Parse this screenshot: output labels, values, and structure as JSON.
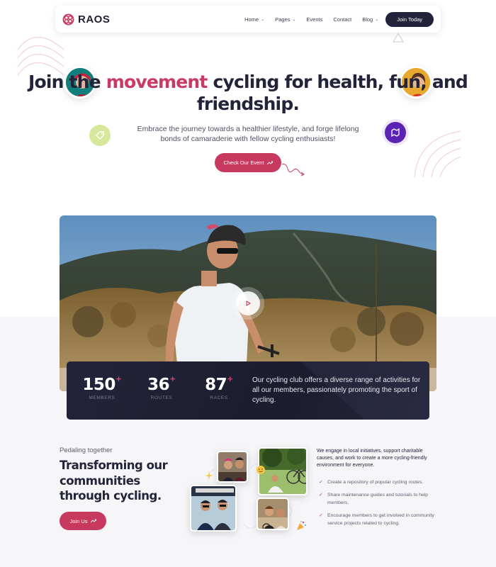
{
  "brand": {
    "name": "RAOS",
    "accent": "#c8395f",
    "dark": "#22233a"
  },
  "nav": {
    "items": [
      {
        "label": "Home",
        "dropdown": true
      },
      {
        "label": "Pages",
        "dropdown": true
      },
      {
        "label": "Events",
        "dropdown": false
      },
      {
        "label": "Contact",
        "dropdown": false
      },
      {
        "label": "Blog",
        "dropdown": true
      }
    ],
    "cta": "Join Today"
  },
  "hero": {
    "title_pre": "Join the ",
    "title_accent": "movement",
    "title_post": " cycling for health, fun, and friendship.",
    "subtitle": "Embrace the journey towards a healthier lifestyle, and forge lifelong bonds of camaraderie with fellow cycling enthusiasts!",
    "cta": "Check Our Event",
    "cta_icon": "arrow-trend-icon"
  },
  "video": {
    "play_icon": "play-icon"
  },
  "stats": {
    "items": [
      {
        "value": "150",
        "suffix": "+",
        "label": "MEMBERS"
      },
      {
        "value": "36",
        "suffix": "+",
        "label": "ROUTES"
      },
      {
        "value": "87",
        "suffix": "+",
        "label": "RACES"
      }
    ],
    "text": "Our cycling club offers a diverse range of activities for all our members, passionately promoting the sport of cycling."
  },
  "community": {
    "eyebrow": "Pedaling together",
    "title": "Transforming our communities through cycling.",
    "cta": "Join Us",
    "intro": "We engage in local initiatives, support charitable causes, and work to create a more cycling-friendly environment for everyone.",
    "checklist": [
      "Create a repository of popular cycling routes.",
      "Share maintenance guides and tutorials to help members.",
      "Encourage members to get involved in community service projects related to cycling."
    ]
  }
}
